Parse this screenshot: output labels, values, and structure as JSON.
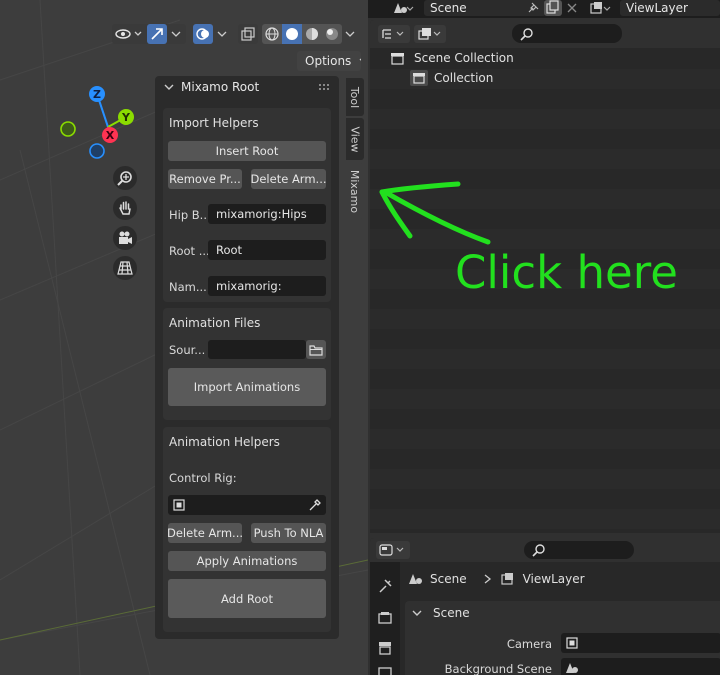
{
  "top_bar": {
    "scene_label": "Scene",
    "view_layer_label": "ViewLayer"
  },
  "viewport": {
    "options_label": "Options",
    "gizmo": {
      "z": "Z",
      "y": "Y",
      "x": "X"
    },
    "nav_icons": [
      "zoom-icon",
      "hand-icon",
      "camera-icon",
      "grid-icon"
    ]
  },
  "npanel": {
    "title": "Mixamo Root",
    "tabs": [
      "Tool",
      "View",
      "Mixamo"
    ],
    "active_tab": "Mixamo",
    "import_helpers": {
      "title": "Import Helpers",
      "insert_root": "Insert Root",
      "remove_prefix": "Remove Pr...",
      "delete_armature": "Delete Arm...",
      "hip_bone_label": "Hip B...",
      "hip_bone_value": "mixamorig:Hips",
      "root_label": "Root ...",
      "root_value": "Root",
      "name_label": "Nam...",
      "name_value": "mixamorig:"
    },
    "animation_files": {
      "title": "Animation Files",
      "source_label": "Sour...",
      "source_value": "",
      "import_button": "Import Animations"
    },
    "animation_helpers": {
      "title": "Animation Helpers",
      "control_rig_label": "Control Rig:",
      "control_rig_value": "",
      "delete_armature": "Delete Arm...",
      "push_to_nla": "Push To NLA",
      "apply_animations": "Apply Animations",
      "add_root": "Add Root"
    }
  },
  "annotation": {
    "text": "Click here",
    "color": "#22e01e"
  },
  "outliner": {
    "search_placeholder": "",
    "scene_collection": "Scene Collection",
    "collection": "Collection"
  },
  "properties": {
    "search_placeholder": "",
    "breadcrumb_scene": "Scene",
    "breadcrumb_view_layer": "ViewLayer",
    "section_title": "Scene",
    "camera_label": "Camera",
    "background_scene_label": "Background Scene"
  },
  "colors": {
    "accent_blue": "#4772b3",
    "axis_x": "#ff3352",
    "axis_y": "#8bdc00",
    "axis_z": "#2890ff"
  }
}
